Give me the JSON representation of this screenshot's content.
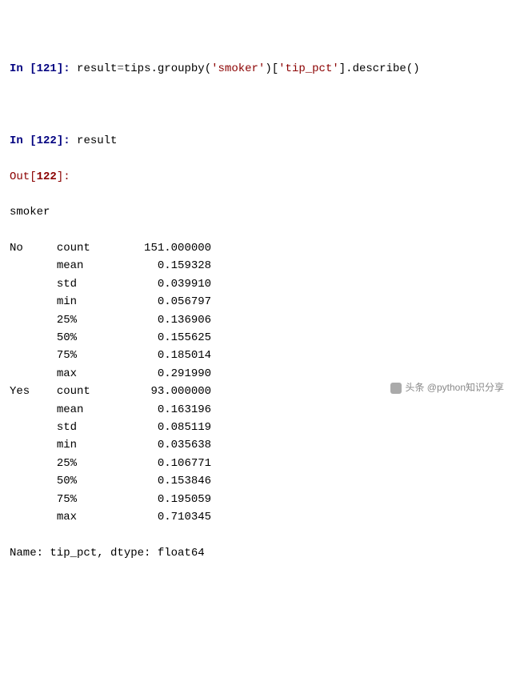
{
  "cells": {
    "c1": {
      "in_label": "In [",
      "in_num": "121",
      "in_close": "]: ",
      "code_lhs": "result",
      "code_eq": "=",
      "code_obj": "tips",
      "code_dot1": ".",
      "code_groupby": "groupby",
      "code_paren_o": "(",
      "code_arg1": "'smoker'",
      "code_paren_c": ")",
      "code_br_o": "[",
      "code_arg2": "'tip_pct'",
      "code_br_c": "]",
      "code_dot2": ".",
      "code_desc": "describe",
      "code_call": "()"
    },
    "c2": {
      "in_label": "In [",
      "in_num": "122",
      "in_close": "]: ",
      "code": "result",
      "out_label": "Out[",
      "out_num": "122",
      "out_close": "]:"
    }
  },
  "output": {
    "index_name": "smoker",
    "groups": [
      {
        "label": "No",
        "stats": [
          {
            "name": "count",
            "value": "151.000000"
          },
          {
            "name": "mean",
            "value": "0.159328"
          },
          {
            "name": "std",
            "value": "0.039910"
          },
          {
            "name": "min",
            "value": "0.056797"
          },
          {
            "name": "25%",
            "value": "0.136906"
          },
          {
            "name": "50%",
            "value": "0.155625"
          },
          {
            "name": "75%",
            "value": "0.185014"
          },
          {
            "name": "max",
            "value": "0.291990"
          }
        ]
      },
      {
        "label": "Yes",
        "stats": [
          {
            "name": "count",
            "value": "93.000000"
          },
          {
            "name": "mean",
            "value": "0.163196"
          },
          {
            "name": "std",
            "value": "0.085119"
          },
          {
            "name": "min",
            "value": "0.035638"
          },
          {
            "name": "25%",
            "value": "0.106771"
          },
          {
            "name": "50%",
            "value": "0.153846"
          },
          {
            "name": "75%",
            "value": "0.195059"
          },
          {
            "name": "max",
            "value": "0.710345"
          }
        ]
      }
    ],
    "footer_line": "Name: tip_pct, dtype: float64"
  },
  "watermark": {
    "text": "头条 @python知识分享"
  }
}
